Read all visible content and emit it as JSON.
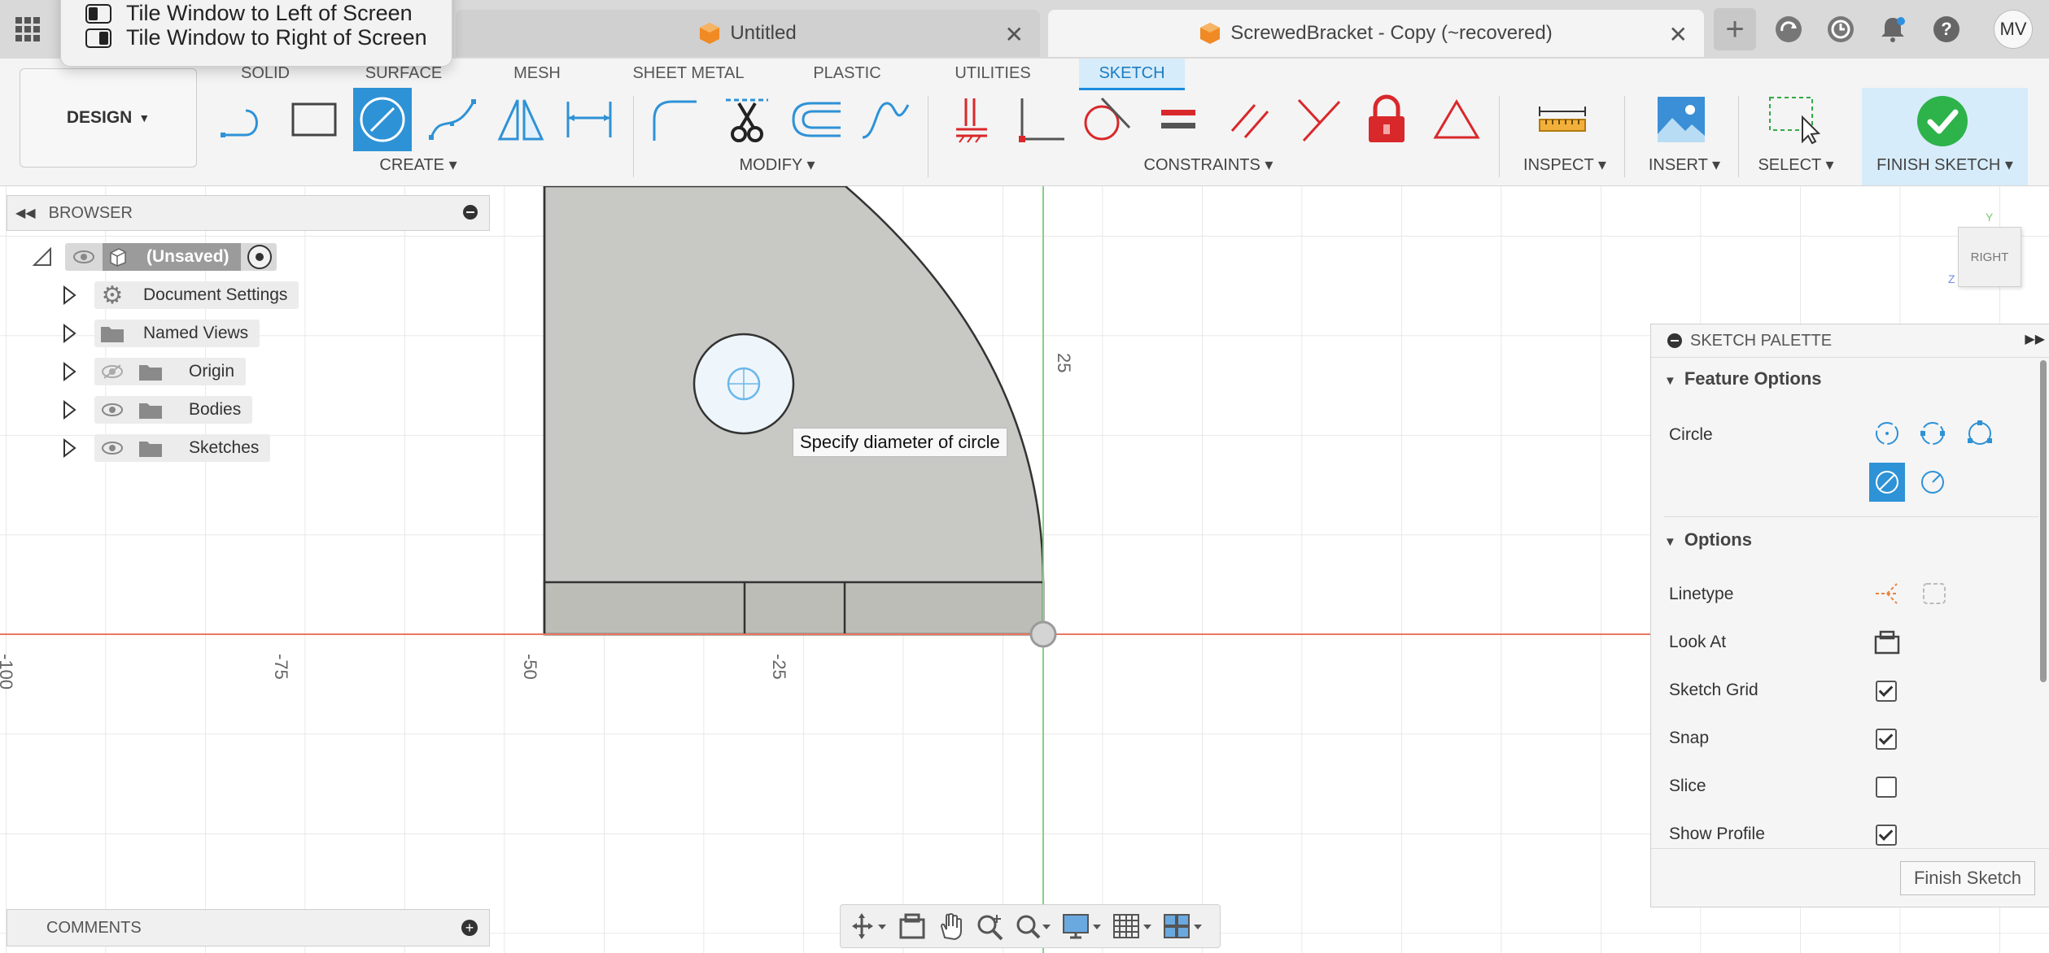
{
  "window_menu": {
    "items": [
      "Tile Window to Left of Screen",
      "Tile Window to Right of Screen"
    ]
  },
  "tabs": [
    {
      "label": "Untitled",
      "active": false
    },
    {
      "label": "ScrewedBracket - Copy (~recovered)",
      "active": true
    }
  ],
  "user": {
    "initials": "MV"
  },
  "workspace": {
    "label": "DESIGN"
  },
  "ribbon_tabs": [
    "SOLID",
    "SURFACE",
    "MESH",
    "SHEET METAL",
    "PLASTIC",
    "UTILITIES",
    "SKETCH"
  ],
  "active_ribbon_tab": "SKETCH",
  "groups": {
    "create": "CREATE",
    "modify": "MODIFY",
    "constraints": "CONSTRAINTS",
    "inspect": "INSPECT",
    "insert": "INSERT",
    "select": "SELECT",
    "finish": "FINISH SKETCH"
  },
  "browser": {
    "title": "BROWSER",
    "root": "(Unsaved)",
    "items": [
      "Document Settings",
      "Named Views",
      "Origin",
      "Bodies",
      "Sketches"
    ]
  },
  "comments": {
    "title": "COMMENTS"
  },
  "viewcube": {
    "face": "RIGHT",
    "axis_y": "Y",
    "axis_z": "Z"
  },
  "canvas": {
    "tooltip": "Specify diameter of circle",
    "axis_labels": [
      "-100",
      "-75",
      "-50",
      "-25",
      "25"
    ]
  },
  "palette": {
    "title": "SKETCH PALETTE",
    "feature_options": "Feature Options",
    "circle_label": "Circle",
    "options_title": "Options",
    "options": [
      {
        "label": "Linetype",
        "type": "icons"
      },
      {
        "label": "Look At",
        "type": "icon"
      },
      {
        "label": "Sketch Grid",
        "type": "check",
        "checked": true
      },
      {
        "label": "Snap",
        "type": "check",
        "checked": true
      },
      {
        "label": "Slice",
        "type": "check",
        "checked": false
      },
      {
        "label": "Show Profile",
        "type": "check",
        "checked": true
      }
    ],
    "finish_button": "Finish Sketch"
  },
  "colors": {
    "accent": "#0696d7",
    "active_tool": "#2e92d6",
    "constraint_red": "#d9282b",
    "finish_green": "#2db34a",
    "x_axis": "#e8775f",
    "y_axis": "#86cf86",
    "body_fill": "#c8c8c4"
  }
}
